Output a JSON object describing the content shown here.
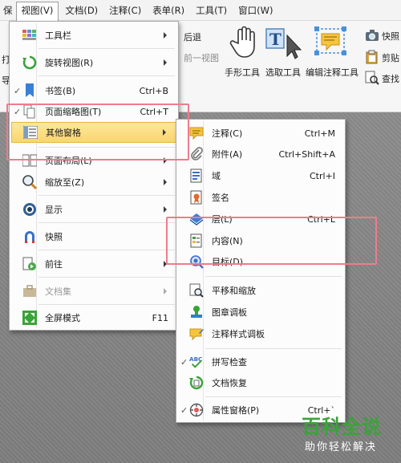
{
  "menubar": [
    {
      "label": "保",
      "active": false
    },
    {
      "label": "视图(V)",
      "active": true
    },
    {
      "label": "文档(D)",
      "active": false
    },
    {
      "label": "注释(C)",
      "active": false
    },
    {
      "label": "表单(R)",
      "active": false
    },
    {
      "label": "工具(T)",
      "active": false
    },
    {
      "label": "窗口(W)",
      "active": false
    }
  ],
  "ribbon": {
    "back": "后退",
    "prev_view": "前一视图",
    "hand_tool": "手形工具",
    "select_tool": "选取工具",
    "edit_annot_tool": "编辑注释工具",
    "snapshot": "快照",
    "clipboard": "剪贴",
    "find": "查找",
    "left_edge": [
      "打",
      "导"
    ]
  },
  "view_menu": {
    "items": [
      {
        "label": "工具栏",
        "shortcut": "",
        "arrow": true,
        "icon": "toolbar-icon",
        "check": false
      },
      {
        "label": "旋转视图(R)",
        "shortcut": "",
        "arrow": true,
        "icon": "rotate-icon",
        "check": false
      },
      {
        "label": "书签(B)",
        "shortcut": "Ctrl+B",
        "arrow": false,
        "icon": "bookmark-icon",
        "check": true
      },
      {
        "label": "页面缩略图(T)",
        "shortcut": "Ctrl+T",
        "arrow": false,
        "icon": "thumbnail-icon",
        "check": true
      },
      {
        "label": "其他窗格",
        "shortcut": "",
        "arrow": true,
        "icon": "pane-icon",
        "check": false,
        "highlight": true
      },
      {
        "label": "页面布局(L)",
        "shortcut": "",
        "arrow": true,
        "icon": "layout-icon",
        "check": false
      },
      {
        "label": "缩放至(Z)",
        "shortcut": "",
        "arrow": true,
        "icon": "zoom-icon",
        "check": false
      },
      {
        "label": "显示",
        "shortcut": "",
        "arrow": true,
        "icon": "eye-icon",
        "check": false
      },
      {
        "label": "快照",
        "shortcut": "",
        "arrow": false,
        "icon": "snapshot-icon",
        "check": false
      },
      {
        "label": "前往",
        "shortcut": "",
        "arrow": true,
        "icon": "goto-icon",
        "check": false
      },
      {
        "label": "文档集",
        "shortcut": "",
        "arrow": true,
        "icon": "portfolio-icon",
        "check": false,
        "disabled": true
      },
      {
        "label": "全屏模式",
        "shortcut": "F11",
        "arrow": false,
        "icon": "fullscreen-icon",
        "check": false
      }
    ]
  },
  "other_pane_menu": {
    "items": [
      {
        "label": "注释(C)",
        "shortcut": "Ctrl+M",
        "icon": "comment-icon",
        "check": false
      },
      {
        "label": "附件(A)",
        "shortcut": "Ctrl+Shift+A",
        "icon": "paperclip-icon",
        "check": false
      },
      {
        "label": "域",
        "shortcut": "Ctrl+I",
        "icon": "field-icon",
        "check": false
      },
      {
        "label": "签名",
        "shortcut": "",
        "icon": "signature-icon",
        "check": false
      },
      {
        "label": "层(L)",
        "shortcut": "Ctrl+L",
        "icon": "layer-icon",
        "check": false
      },
      {
        "label": "内容(N)",
        "shortcut": "",
        "icon": "content-icon",
        "check": false
      },
      {
        "label": "目标(D)",
        "shortcut": "",
        "icon": "destination-icon",
        "check": false
      },
      {
        "label": "平移和缩放",
        "shortcut": "",
        "icon": "pan-zoom-icon",
        "check": false
      },
      {
        "label": "图章调板",
        "shortcut": "",
        "icon": "stamp-icon",
        "check": false
      },
      {
        "label": "注释样式调板",
        "shortcut": "",
        "icon": "annot-style-icon",
        "check": false
      },
      {
        "label": "拼写检查",
        "shortcut": "",
        "icon": "spellcheck-icon",
        "check": true
      },
      {
        "label": "文档恢复",
        "shortcut": "",
        "icon": "recover-icon",
        "check": false
      },
      {
        "label": "属性窗格(P)",
        "shortcut": "Ctrl+`",
        "icon": "properties-icon",
        "check": true
      }
    ]
  },
  "watermark": {
    "title": "百科全说",
    "subtitle": "助你轻松解决"
  },
  "colors": {
    "highlight": "#f9d66c",
    "annotation_box": "#ee7c8c",
    "watermark_green": "#3aa33a"
  }
}
